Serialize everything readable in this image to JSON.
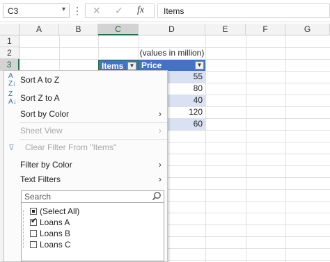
{
  "formula_bar": {
    "name_box": "C3",
    "name_box_arrow": "▾",
    "cancel_icon": "✕",
    "enter_icon": "✓",
    "fx_label": "fx",
    "formula": "Items"
  },
  "columns": [
    "A",
    "B",
    "C",
    "D",
    "E",
    "F",
    "G"
  ],
  "rows": [
    "1",
    "2",
    "3"
  ],
  "cells": {
    "note": "(values in million)",
    "header_items": "Items",
    "header_price": "Price",
    "prices": [
      "55",
      "80",
      "40",
      "120",
      "60"
    ]
  },
  "filter_menu": {
    "sort_az": "Sort A to Z",
    "sort_za": "Sort Z to A",
    "sort_by_color": "Sort by Color",
    "sheet_view": "Sheet View",
    "clear_filter": "Clear Filter From \"Items\"",
    "filter_by_color": "Filter by Color",
    "text_filters": "Text Filters",
    "search_placeholder": "Search",
    "items": [
      {
        "label": "(Select All)",
        "state": "partial"
      },
      {
        "label": "Loans A",
        "state": "checked"
      },
      {
        "label": "Loans B",
        "state": "unchecked"
      },
      {
        "label": "Loans C",
        "state": "unchecked"
      }
    ],
    "submenu_arrow": "›"
  },
  "colors": {
    "table_header": "#4472c4",
    "band": "#d9e1f2",
    "active_header": "#217346"
  }
}
